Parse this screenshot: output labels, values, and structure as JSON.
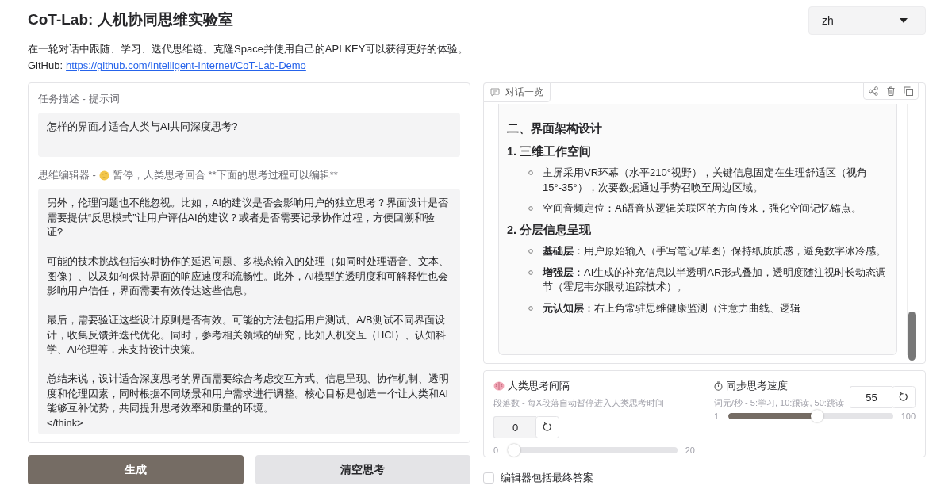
{
  "header": {
    "title": "CoT-Lab: 人机协同思维实验室",
    "description": "在一轮对话中跟随、学习、迭代思维链。克隆Space并使用自己的API KEY可以获得更好的体验。",
    "github_label": "GitHub:",
    "github_link": "https://github.com/Intelligent-Internet/CoT-Lab-Demo"
  },
  "language_select": {
    "value": "zh"
  },
  "task": {
    "label": "任务描述 - 提示词",
    "value": "怎样的界面才适合人类与AI共同深度思考?"
  },
  "editor": {
    "label_prefix": "思维编辑器 -",
    "label_text": "暂停，人类思考回合 **下面的思考过程可以编辑**",
    "paragraphs": [
      "另外，伦理问题也不能忽视。比如，AI的建议是否会影响用户的独立思考？界面设计是否需要提供“反思模式”让用户评估AI的建议？或者是否需要记录协作过程，方便回溯和验证?",
      "可能的技术挑战包括实时协作的延迟问题、多模态输入的处理（如同时处理语音、文本、图像）、以及如何保持界面的响应速度和流畅性。此外，AI模型的透明度和可解释性也会影响用户信任，界面需要有效传达这些信息。",
      "最后，需要验证这些设计原则是否有效。可能的方法包括用户测试、A/B测试不同界面设计，收集反馈并迭代优化。同时，参考相关领域的研究，比如人机交互（HCI）、认知科学、AI伦理等，来支持设计决策。",
      "总结来说，设计适合深度思考的界面需要综合考虑交互方式、信息呈现、协作机制、透明度和伦理因素，同时根据不同场景和用户需求进行调整。核心目标是创造一个让人类和AI能够互补优势，共同提升思考效率和质量的环境。",
      "</think>"
    ]
  },
  "buttons": [
    {
      "label": "生成",
      "kind": "primary"
    },
    {
      "label": "清空思考",
      "kind": "secondary"
    }
  ],
  "chat": {
    "label": "对话一览",
    "content": [
      {
        "kind": "heading",
        "text": "二、界面架构设计"
      },
      {
        "kind": "subheading",
        "text": "1. 三维工作空间"
      },
      {
        "kind": "bullet",
        "text": "主屏采用VR环幕（水平210°视野），关键信息固定在生理舒适区（视角15°-35°），次要数据通过手势召唤至周边区域。"
      },
      {
        "kind": "bullet",
        "text": "空间音频定位：AI语音从逻辑关联区的方向传来，强化空间记忆锚点。"
      },
      {
        "kind": "subheading",
        "text": "2. 分层信息呈现"
      },
      {
        "kind": "bullet",
        "text": "**基础层**：用户原始输入（手写笔记/草图）保持纸质质感，避免数字冰冷感。"
      },
      {
        "kind": "bullet",
        "text": "**增强层**：AI生成的补充信息以半透明AR形式叠加，透明度随注视时长动态调节（霍尼韦尔眼动追踪技术）。"
      },
      {
        "kind": "bullet",
        "text": "**元认知层**：右上角常驻思维健康监测（注意力曲线、逻辑"
      }
    ]
  },
  "settings": [
    {
      "title": "人类思考间隔",
      "hint": "段落数 - 每X段落自动暂停进入人类思考时间",
      "value": "0",
      "min": "0",
      "max": "20",
      "level": 0
    },
    {
      "title": "同步思考速度",
      "hint": "词元/秒 - 5:学习, 10:跟读, 50:跳读",
      "value": "55",
      "min": "1",
      "max": "100",
      "level": 0.545
    }
  ],
  "include_answer": {
    "label": "编辑器包括最终答案",
    "checked": false
  }
}
